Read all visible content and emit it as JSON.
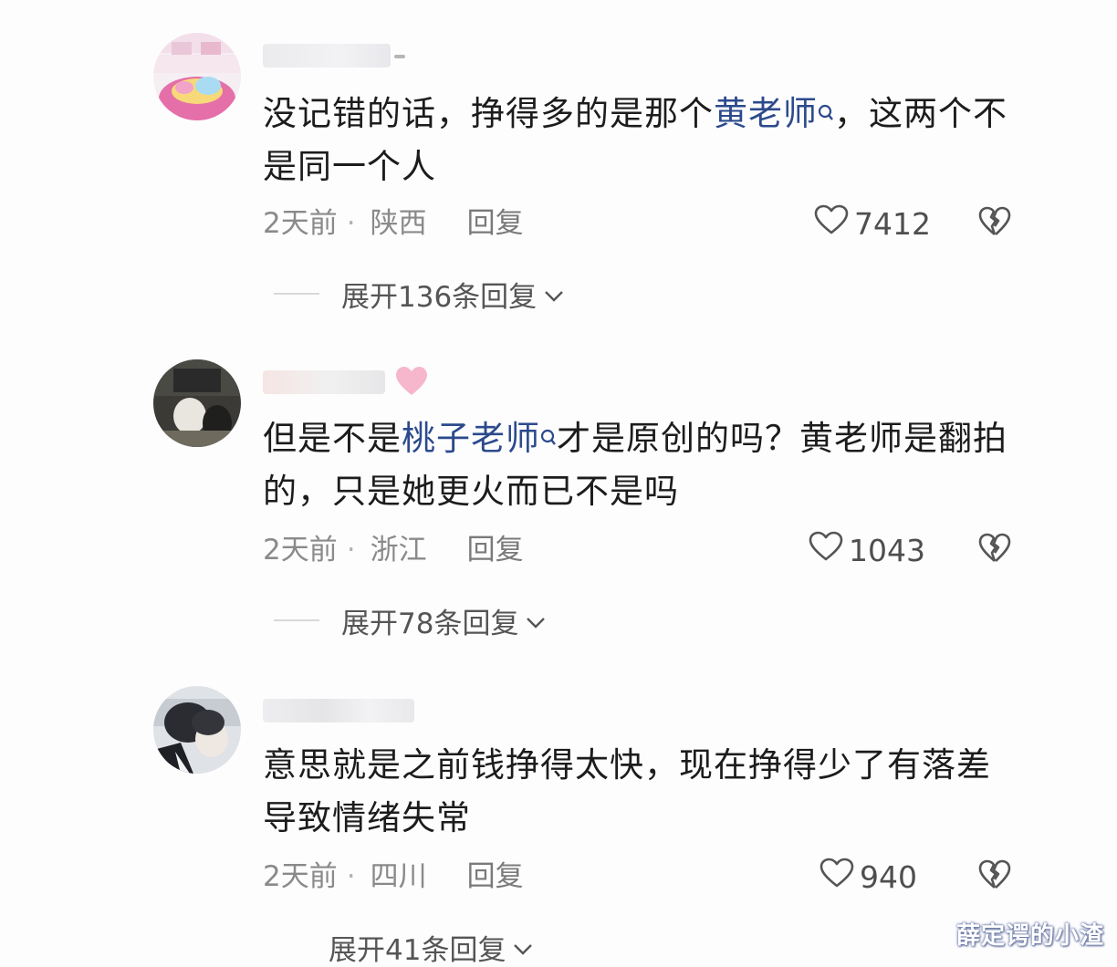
{
  "comments": [
    {
      "text_before": "没记错的话，挣得多的是那个",
      "mention": "黄老师",
      "text_after": "，这两个不是同一个人",
      "time": "2天前",
      "location": "陕西",
      "reply_label": "回复",
      "likes": "7412",
      "expand_label": "展开136条回复"
    },
    {
      "text_before": "但是不是",
      "mention": "桃子老师",
      "text_after": "才是原创的吗？黄老师是翻拍的，只是她更火而已不是吗",
      "time": "2天前",
      "location": "浙江",
      "reply_label": "回复",
      "likes": "1043",
      "expand_label": "展开78条回复"
    },
    {
      "text_before": "意思就是之前钱挣得太快，现在挣得少了有落差导致情绪失常",
      "mention": "",
      "text_after": "",
      "time": "2天前",
      "location": "四川",
      "reply_label": "回复",
      "likes": "940",
      "expand_label": "展开41条回复"
    }
  ],
  "watermark": "薛定谔的小渣",
  "icons": {
    "like": "heart-outline-icon",
    "dislike": "broken-heart-icon",
    "expand": "chevron-down-icon",
    "mention": "search-icon"
  },
  "colors": {
    "mention": "#2c4a8c",
    "text": "#1c1c1c",
    "meta": "#8a8a8a"
  }
}
